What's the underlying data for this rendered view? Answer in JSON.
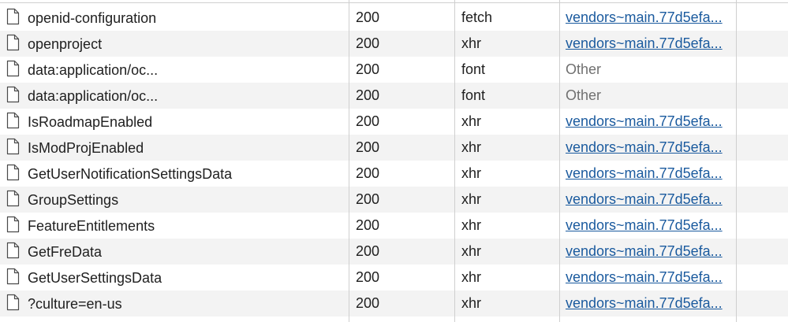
{
  "network_rows": [
    {
      "name": "openid-configuration",
      "status": "200",
      "type": "fetch",
      "initiator": "vendors~main.77d5efa...",
      "initiator_is_link": true
    },
    {
      "name": "openproject",
      "status": "200",
      "type": "xhr",
      "initiator": "vendors~main.77d5efa...",
      "initiator_is_link": true
    },
    {
      "name": "data:application/oc...",
      "status": "200",
      "type": "font",
      "initiator": "Other",
      "initiator_is_link": false
    },
    {
      "name": "data:application/oc...",
      "status": "200",
      "type": "font",
      "initiator": "Other",
      "initiator_is_link": false
    },
    {
      "name": "IsRoadmapEnabled",
      "status": "200",
      "type": "xhr",
      "initiator": "vendors~main.77d5efa...",
      "initiator_is_link": true
    },
    {
      "name": "IsModProjEnabled",
      "status": "200",
      "type": "xhr",
      "initiator": "vendors~main.77d5efa...",
      "initiator_is_link": true
    },
    {
      "name": "GetUserNotificationSettingsData",
      "status": "200",
      "type": "xhr",
      "initiator": "vendors~main.77d5efa...",
      "initiator_is_link": true
    },
    {
      "name": "GroupSettings",
      "status": "200",
      "type": "xhr",
      "initiator": "vendors~main.77d5efa...",
      "initiator_is_link": true
    },
    {
      "name": "FeatureEntitlements",
      "status": "200",
      "type": "xhr",
      "initiator": "vendors~main.77d5efa...",
      "initiator_is_link": true
    },
    {
      "name": "GetFreData",
      "status": "200",
      "type": "xhr",
      "initiator": "vendors~main.77d5efa...",
      "initiator_is_link": true
    },
    {
      "name": "GetUserSettingsData",
      "status": "200",
      "type": "xhr",
      "initiator": "vendors~main.77d5efa...",
      "initiator_is_link": true
    },
    {
      "name": "?culture=en-us",
      "status": "200",
      "type": "xhr",
      "initiator": "vendors~main.77d5efa...",
      "initiator_is_link": true
    }
  ],
  "colors": {
    "link": "#1a5a9e",
    "muted": "#707070",
    "row_alt": "#f3f3f3",
    "grid_line": "#cfcfcf"
  },
  "icons": {
    "row_icon": "document-icon"
  }
}
